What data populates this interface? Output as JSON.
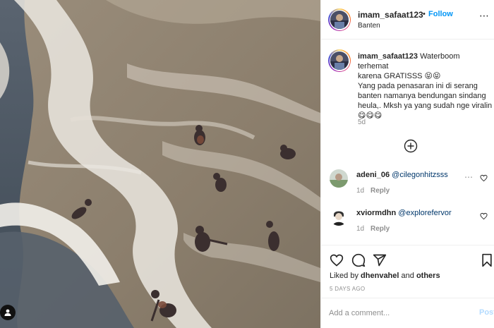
{
  "post": {
    "username": "imam_safaat123",
    "separator": "•",
    "follow_label": "Follow",
    "location": "Banten"
  },
  "caption": {
    "username": "imam_safaat123",
    "text_line1": "Waterboom terhemat",
    "text_line2": "karena GRATISSS 😝😝",
    "text_line3": "Yang pada penasaran ini di serang",
    "text_line4": "banten namanya bendungan sindang",
    "text_line5": "heula,. Mksh ya yang sudah nge viralin",
    "text_line6": "😋😋😋",
    "age": "5d"
  },
  "load_more_icon": "plus-circle-icon",
  "comments": [
    {
      "username": "adeni_06",
      "mention": "@cilegonhitzsss",
      "age": "1d",
      "reply_label": "Reply"
    },
    {
      "username": "xviormdhn",
      "mention": "@explorefervor",
      "age": "1d",
      "reply_label": "Reply"
    }
  ],
  "likes": {
    "prefix": "Liked by",
    "user": "dhenvahel",
    "conj": "and",
    "others": "others"
  },
  "date": "5 DAYS AGO",
  "comment_input": {
    "placeholder": "Add a comment..."
  },
  "post_label": "Post",
  "colors": {
    "link_blue": "#0095f6",
    "mention_blue": "#00376b",
    "muted": "#8e8e8e",
    "post_disabled": "#b3dbff"
  }
}
